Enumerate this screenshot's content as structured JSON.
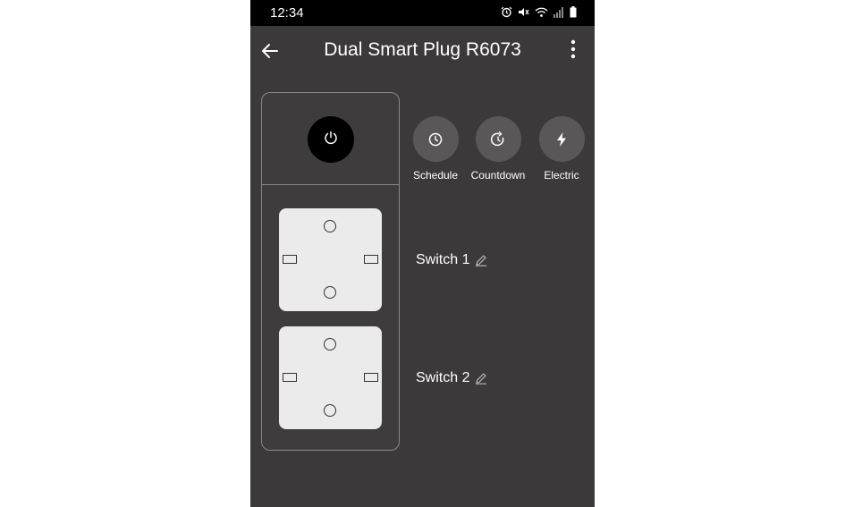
{
  "status_bar": {
    "time": "12:34",
    "icons": [
      "alarm-icon",
      "mute-icon",
      "wifi-icon",
      "signal-icon",
      "battery-icon"
    ]
  },
  "app_bar": {
    "title": "Dual Smart Plug R6073",
    "back_icon": "back-arrow-icon",
    "menu_icon": "more-vertical-icon"
  },
  "device": {
    "power_icon": "power-icon"
  },
  "actions": [
    {
      "label": "Schedule",
      "icon": "clock-icon"
    },
    {
      "label": "Countdown",
      "icon": "countdown-icon"
    },
    {
      "label": "Electric",
      "icon": "lightning-icon"
    }
  ],
  "switches": [
    {
      "label": "Switch 1",
      "edit_icon": "pencil-icon"
    },
    {
      "label": "Switch 2",
      "edit_icon": "pencil-icon"
    }
  ],
  "colors": {
    "background": "#3c393b",
    "status_bar": "#000000",
    "action_circle": "#5a5759",
    "socket": "#ebebeb",
    "power_button": "#000000"
  }
}
